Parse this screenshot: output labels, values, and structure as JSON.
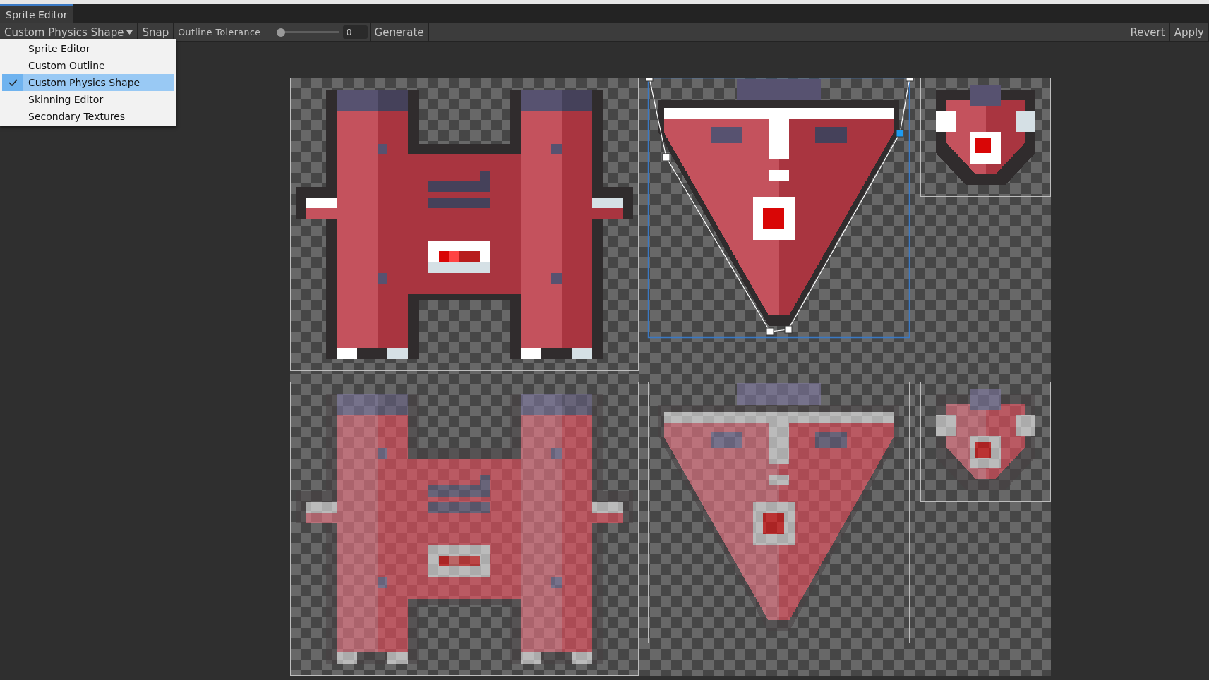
{
  "window": {
    "tab": "Sprite Editor"
  },
  "toolbar": {
    "mode_dropdown": "Custom Physics Shape",
    "snap": "Snap",
    "outline_tolerance": {
      "label": "Outline Tolerance",
      "level": 0,
      "value": "0"
    },
    "generate": "Generate",
    "revert": "Revert",
    "apply": "Apply"
  },
  "mode_menu": {
    "items": [
      {
        "label": "Sprite Editor",
        "selected": false
      },
      {
        "label": "Custom Outline",
        "selected": false
      },
      {
        "label": "Custom Physics Shape",
        "selected": true
      },
      {
        "label": "Skinning Editor",
        "selected": false
      },
      {
        "label": "Secondary Textures",
        "selected": false
      }
    ]
  },
  "sprites": [
    {
      "kind": "robot",
      "selected": false,
      "faded": false
    },
    {
      "kind": "shield",
      "selected": true,
      "faded": false,
      "handles": [
        {
          "selected": false
        },
        {
          "selected": false
        },
        {
          "selected": true
        },
        {
          "selected": false
        },
        {
          "selected": false
        },
        {
          "selected": false
        }
      ]
    },
    {
      "kind": "heart",
      "selected": false,
      "faded": false
    },
    {
      "kind": "robot",
      "selected": false,
      "faded": true
    },
    {
      "kind": "shield",
      "selected": false,
      "faded": true
    },
    {
      "kind": "heart",
      "selected": false,
      "faded": true
    }
  ]
}
